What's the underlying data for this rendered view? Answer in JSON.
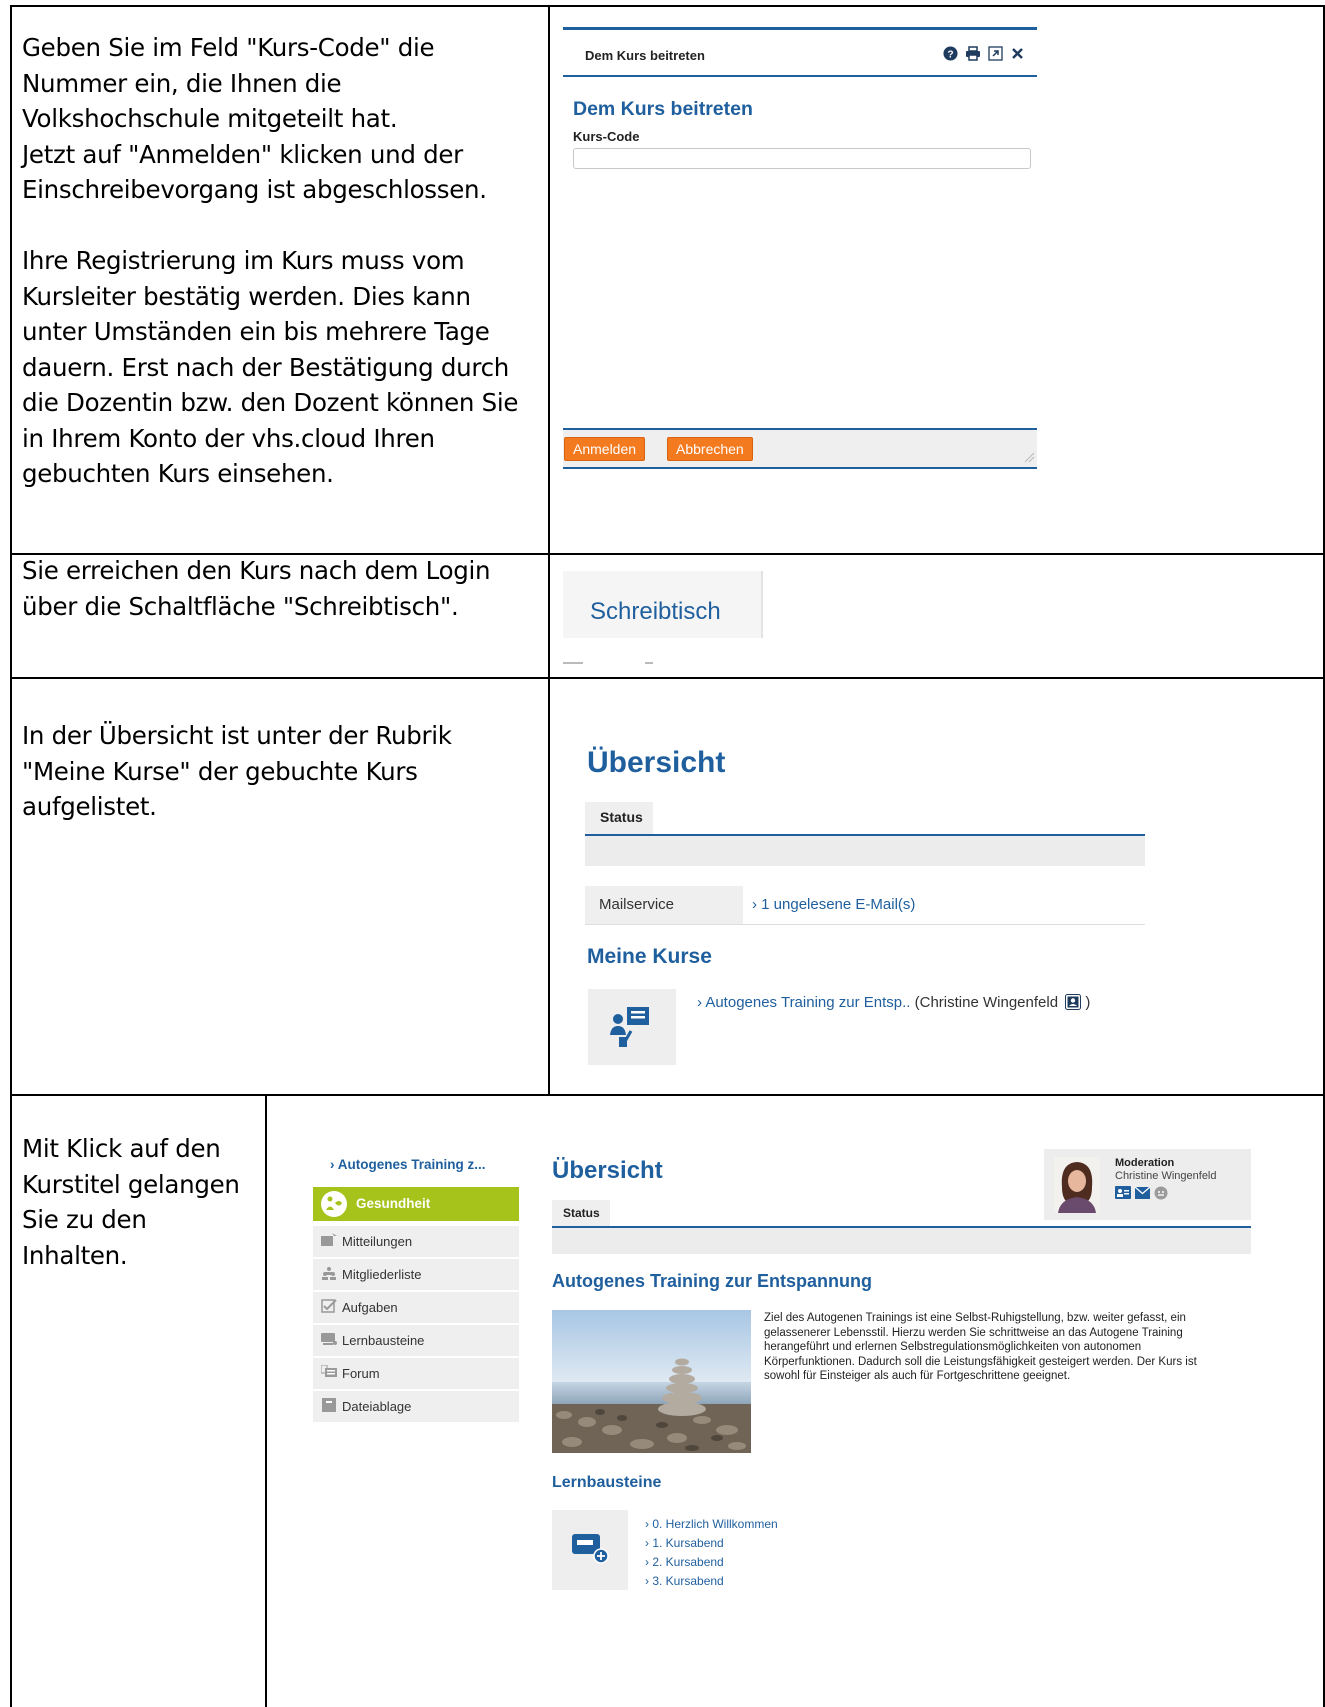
{
  "row1": {
    "instruction": "Geben Sie im Feld \"Kurs-Code\" die\nNummer ein, die Ihnen die\nVolkshochschule mitgeteilt hat.\nJetzt auf \"Anmelden\" klicken und der\nEinschreibevorgang ist abgeschlossen.\n\nIhre Registrierung im Kurs muss vom\nKursleiter bestätig werden. Dies kann\nunter Umständen ein bis mehrere Tage\ndauern. Erst nach der Bestätigung durch\ndie Dozentin bzw. den Dozent können Sie\nin Ihrem Konto der vhs.cloud Ihren\ngebuchten Kurs einsehen.",
    "dialog": {
      "window_title": "Dem Kurs beitreten",
      "heading": "Dem Kurs beitreten",
      "field_label": "Kurs-Code",
      "field_value": "",
      "submit_label": "Anmelden",
      "cancel_label": "Abbrechen",
      "tools": [
        "help-icon",
        "print-icon",
        "popout-icon",
        "close-icon"
      ]
    }
  },
  "row2": {
    "instruction": "Sie erreichen den Kurs nach dem Login\nüber die Schaltfläche \"Schreibtisch\".",
    "button_label": "Schreibtisch"
  },
  "row3": {
    "instruction": "In der Übersicht ist unter der Rubrik\n\"Meine Kurse\" der gebuchte Kurs\naufgelistet.",
    "title": "Übersicht",
    "status_tab": "Status",
    "mail_label": "Mailservice",
    "mail_link": "› 1 ungelesene E-Mail(s)",
    "courses_heading": "Meine Kurse",
    "course_link": "› Autogenes Training zur Entsp..",
    "course_teacher": "(Christine Wingenfeld",
    "course_teacher_end": ")"
  },
  "row4": {
    "instruction": "Mit Klick auf den\nKurstitel gelangen\nSie zu den\nInhalten.",
    "course_crumb": "› Autogenes Training z...",
    "category": "Gesundheit",
    "menu": [
      {
        "label": "Mitteilungen",
        "icon": "announcement-icon"
      },
      {
        "label": "Mitgliederliste",
        "icon": "members-icon"
      },
      {
        "label": "Aufgaben",
        "icon": "tasks-icon"
      },
      {
        "label": "Lernbausteine",
        "icon": "modules-icon"
      },
      {
        "label": "Forum",
        "icon": "forum-icon"
      },
      {
        "label": "Dateiablage",
        "icon": "files-icon"
      }
    ],
    "title": "Übersicht",
    "status_tab": "Status",
    "moderation_label": "Moderation",
    "moderator_name": "Christine Wingenfeld",
    "course_title": "Autogenes Training zur Entspannung",
    "description": "Ziel des Autogenen Trainings ist eine Selbst-Ruhigstellung, bzw. weiter gefasst, ein\ngelassenerer Lebensstil. Hierzu werden Sie schrittweise an das Autogene Training\nherangeführt und erlernen Selbstregulationsmöglichkeiten von autonomen\nKörperfunktionen. Dadurch soll die Leistungsfähigkeit gesteigert werden. Der Kurs ist\nsowohl für Einsteiger als auch für Fortgeschrittene geeignet.",
    "modules_heading": "Lernbausteine",
    "modules": [
      "› 0. Herzlich Willkommen",
      "› 1. Kursabend",
      "› 2. Kursabend",
      "› 3. Kursabend"
    ]
  },
  "colors": {
    "accent_blue": "#1f5f9e",
    "button_orange": "#f47a1f",
    "category_green": "#a5c31b"
  }
}
